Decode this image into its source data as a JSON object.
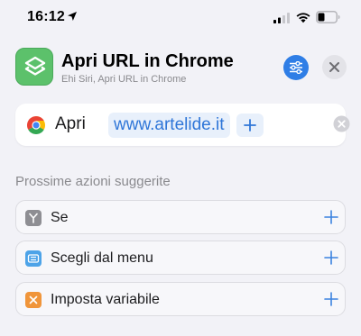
{
  "status_bar": {
    "time": "16:12",
    "icons": [
      "location-arrow-icon",
      "cellular-signal-icon",
      "wifi-icon",
      "battery-icon"
    ]
  },
  "header": {
    "title": "Apri URL in Chrome",
    "subtitle": "Ehi Siri, Apri URL in Chrome",
    "icon": "shortcuts-icon",
    "icon_color": "#5cc16b",
    "settings_icon": "sliders-icon",
    "settings_color": "#2f7ee6",
    "close_icon": "close-icon"
  },
  "action": {
    "app_icon": "chrome-icon",
    "verb": "Apri",
    "url": "www.artelide.it",
    "add_icon": "plus-icon",
    "clear_icon": "clear-icon",
    "accent": "#2f76d8"
  },
  "suggestions": {
    "title": "Prossime azioni suggerite",
    "items": [
      {
        "label": "Se",
        "icon": "branch-icon",
        "color": "#8e8e93"
      },
      {
        "label": "Scegli dal menu",
        "icon": "menu-icon",
        "color": "#4da3e8"
      },
      {
        "label": "Imposta variabile",
        "icon": "variable-icon",
        "color": "#f0953a"
      }
    ]
  }
}
